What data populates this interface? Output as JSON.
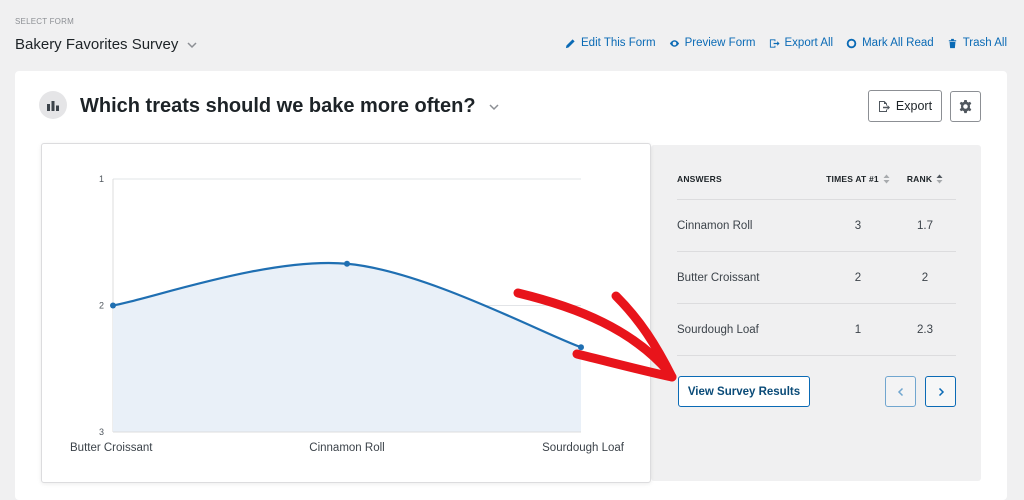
{
  "header": {
    "select_label": "SELECT FORM",
    "form_name": "Bakery Favorites Survey",
    "actions": [
      {
        "label": "Edit This Form",
        "icon": "pencil-icon"
      },
      {
        "label": "Preview Form",
        "icon": "eye-icon"
      },
      {
        "label": "Export All",
        "icon": "export-icon"
      },
      {
        "label": "Mark All Read",
        "icon": "circle-icon"
      },
      {
        "label": "Trash All",
        "icon": "trash-icon"
      }
    ]
  },
  "question": {
    "title": "Which treats should we bake more often?",
    "export_label": "Export"
  },
  "table": {
    "headers": {
      "answers": "ANSWERS",
      "times": "TIMES AT #1",
      "rank": "RANK"
    },
    "rows": [
      {
        "answer": "Cinnamon Roll",
        "times": "3",
        "rank": "1.7"
      },
      {
        "answer": "Butter Croissant",
        "times": "2",
        "rank": "2"
      },
      {
        "answer": "Sourdough Loaf",
        "times": "1",
        "rank": "2.3"
      }
    ],
    "view_results_label": "View Survey Results"
  },
  "colors": {
    "accent": "#0a6ab5",
    "line": "#1f6fb2",
    "fill": "#e9f0f8",
    "annotation_arrow": "#e8141b"
  },
  "chart_data": {
    "type": "area",
    "categories": [
      "Butter Croissant",
      "Cinnamon Roll",
      "Sourdough Loaf"
    ],
    "values": [
      2,
      1.67,
      2.33
    ],
    "ylim": [
      1,
      3
    ],
    "y_ticks": [
      "1",
      "2",
      "3"
    ],
    "y_reversed": true,
    "grid": true,
    "title": "",
    "xlabel": "",
    "ylabel": ""
  }
}
